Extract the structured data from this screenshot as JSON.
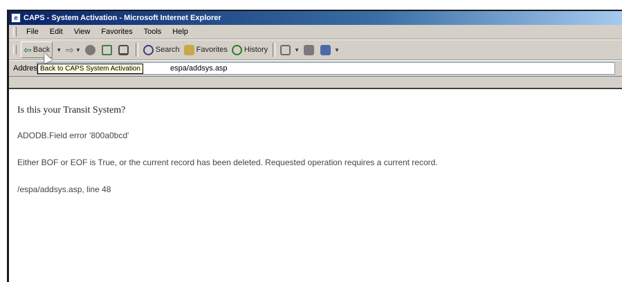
{
  "window": {
    "title": "CAPS - System Activation - Microsoft Internet Explorer"
  },
  "menubar": {
    "items": [
      "File",
      "Edit",
      "View",
      "Favorites",
      "Tools",
      "Help"
    ]
  },
  "toolbar": {
    "back_label": "Back",
    "search_label": "Search",
    "favorites_label": "Favorites",
    "history_label": "History"
  },
  "addressbar": {
    "label": "Address",
    "url_visible": "espa/addsys.asp"
  },
  "tooltip": {
    "text": "Back to CAPS System Activation"
  },
  "page": {
    "heading": "Is this your Transit System?",
    "error_title": "ADODB.Field error '800a0bcd'",
    "error_message": "Either BOF or EOF is True, or the current record has been deleted. Requested operation requires a current record.",
    "error_location": "/espa/addsys.asp, line 48"
  }
}
